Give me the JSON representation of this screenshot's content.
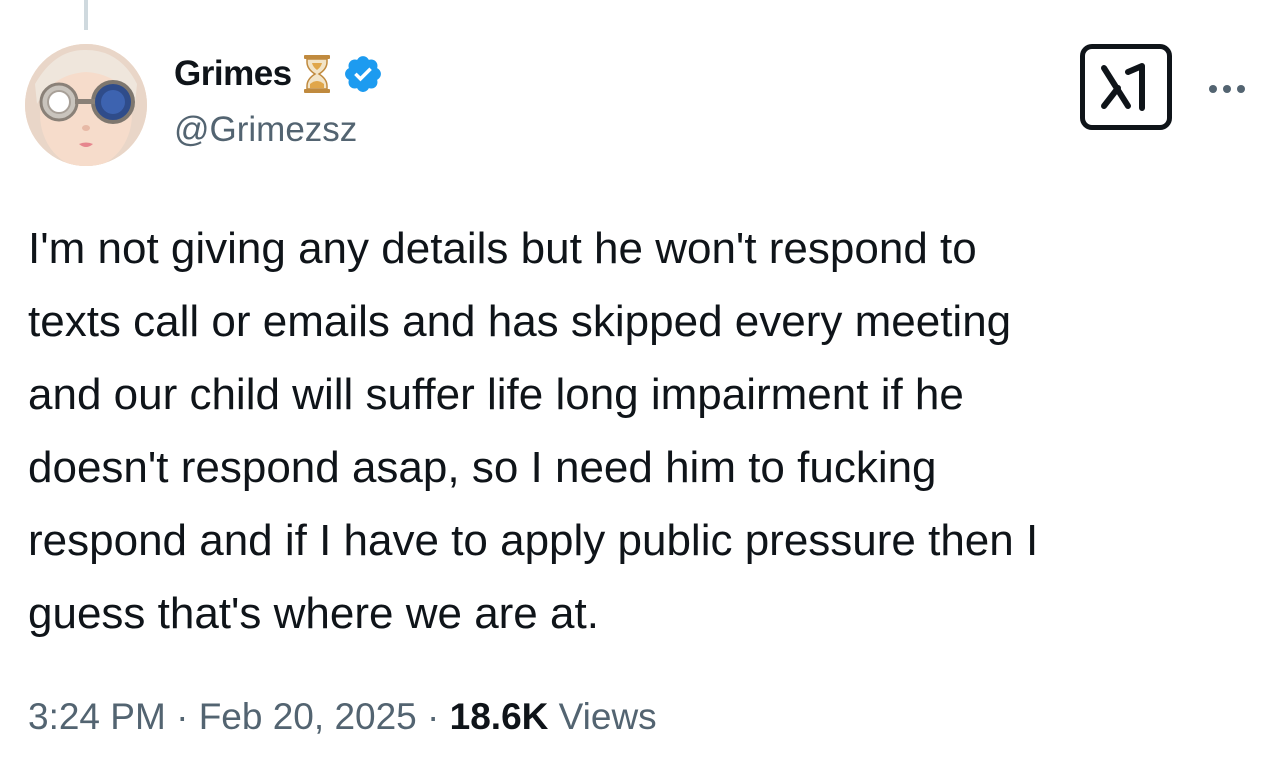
{
  "author": {
    "display_name": "Grimes",
    "handle": "@Grimezsz",
    "avatar_icon": "avatar-image",
    "badges": [
      "hourglass-icon",
      "verified-badge-icon"
    ]
  },
  "actions": {
    "grok_icon": "grok-icon",
    "more_icon": "more-options-icon"
  },
  "tweet": {
    "text": "I'm not giving any details but he won't respond to\ntexts call or emails and has skipped every meeting\nand our child will suffer life long impairment if he\ndoesn't respond asap, so I need him to fucking\nrespond and if I have to apply public pressure then I\nguess that's where we are at."
  },
  "meta": {
    "time": "3:24 PM",
    "separator": " · ",
    "date": "Feb 20, 2025",
    "views_count": "18.6K",
    "views_label": " Views"
  },
  "colors": {
    "text_primary": "#0f1419",
    "text_secondary": "#536471",
    "verified_blue": "#1d9bf0",
    "thread_line": "#cfd9de"
  }
}
